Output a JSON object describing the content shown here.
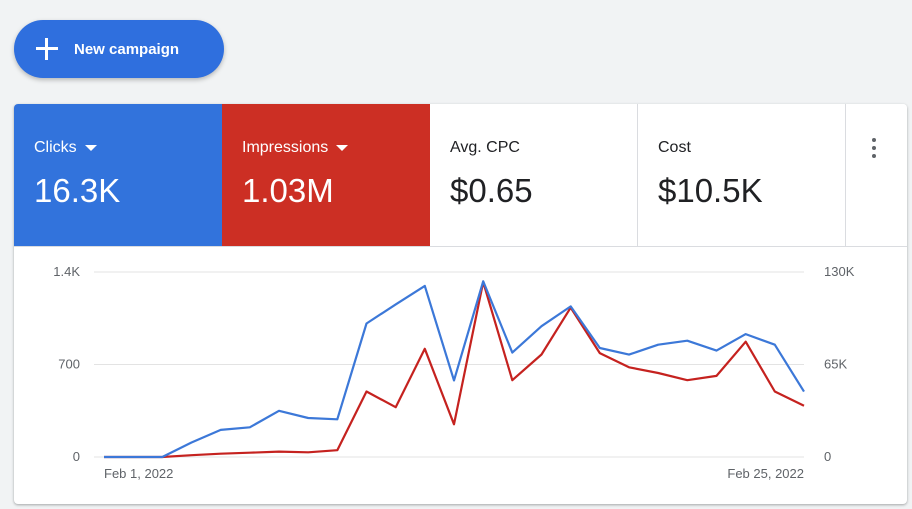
{
  "new_campaign_label": "New campaign",
  "metrics": [
    {
      "label": "Clicks",
      "value": "16.3K",
      "has_dropdown": true,
      "color": "#3273dc"
    },
    {
      "label": "Impressions",
      "value": "1.03M",
      "has_dropdown": true,
      "color": "#cc2f24"
    },
    {
      "label": "Avg. CPC",
      "value": "$0.65",
      "has_dropdown": false
    },
    {
      "label": "Cost",
      "value": "$10.5K",
      "has_dropdown": false
    }
  ],
  "more_menu_icon": "vertical-dots-icon",
  "chart_data": {
    "type": "line",
    "x": [
      "Feb 1, 2022",
      "Feb 2",
      "Feb 3",
      "Feb 4",
      "Feb 5",
      "Feb 6",
      "Feb 7",
      "Feb 8",
      "Feb 9",
      "Feb 10",
      "Feb 11",
      "Feb 12",
      "Feb 13",
      "Feb 14",
      "Feb 15",
      "Feb 16",
      "Feb 17",
      "Feb 18",
      "Feb 19",
      "Feb 20",
      "Feb 21",
      "Feb 22",
      "Feb 23",
      "Feb 24",
      "Feb 25, 2022"
    ],
    "x_tick_labels": [
      "Feb 1, 2022",
      "Feb 25, 2022"
    ],
    "series": [
      {
        "name": "Clicks",
        "axis": "left",
        "color": "#3c78d8",
        "values": [
          0,
          0,
          0,
          110,
          205,
          225,
          350,
          295,
          285,
          1010,
          1155,
          1295,
          580,
          1330,
          790,
          990,
          1140,
          825,
          775,
          850,
          880,
          805,
          930,
          850,
          495
        ]
      },
      {
        "name": "Impressions",
        "axis": "right",
        "color": "#c5221f",
        "values": [
          0,
          0,
          0,
          1300,
          2300,
          3000,
          3800,
          3300,
          4800,
          46000,
          35000,
          76000,
          23000,
          123000,
          54000,
          72000,
          105000,
          73000,
          63000,
          59000,
          54000,
          57000,
          81000,
          46000,
          36000
        ]
      }
    ],
    "y_left": {
      "ticks": [
        "0",
        "700",
        "1.4K"
      ],
      "ylim": [
        0,
        1400
      ]
    },
    "y_right": {
      "ticks": [
        "0",
        "65K",
        "130K"
      ],
      "ylim": [
        0,
        130000
      ]
    },
    "grid": true
  }
}
